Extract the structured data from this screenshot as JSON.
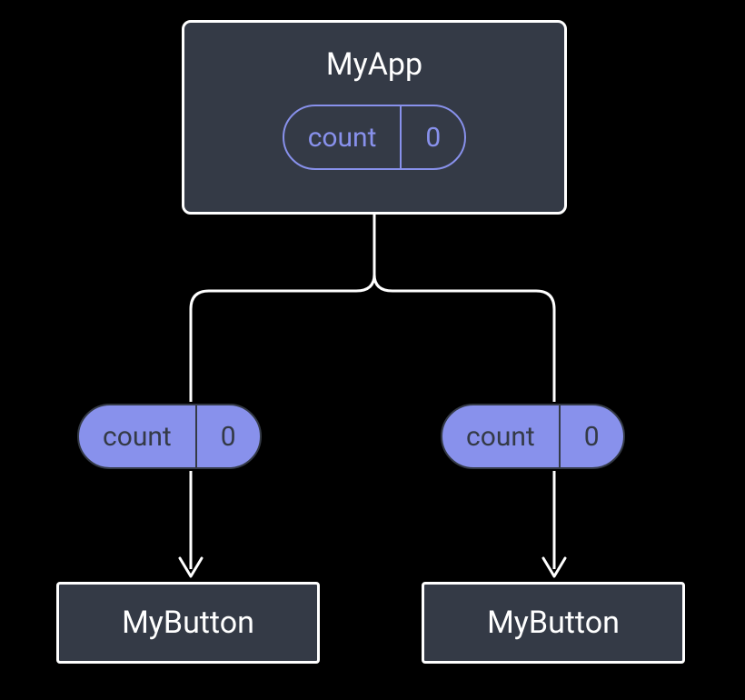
{
  "parent": {
    "name": "MyApp",
    "state": {
      "label": "count",
      "value": "0"
    }
  },
  "props": {
    "left": {
      "label": "count",
      "value": "0"
    },
    "right": {
      "label": "count",
      "value": "0"
    }
  },
  "children": {
    "left": {
      "name": "MyButton"
    },
    "right": {
      "name": "MyButton"
    }
  }
}
